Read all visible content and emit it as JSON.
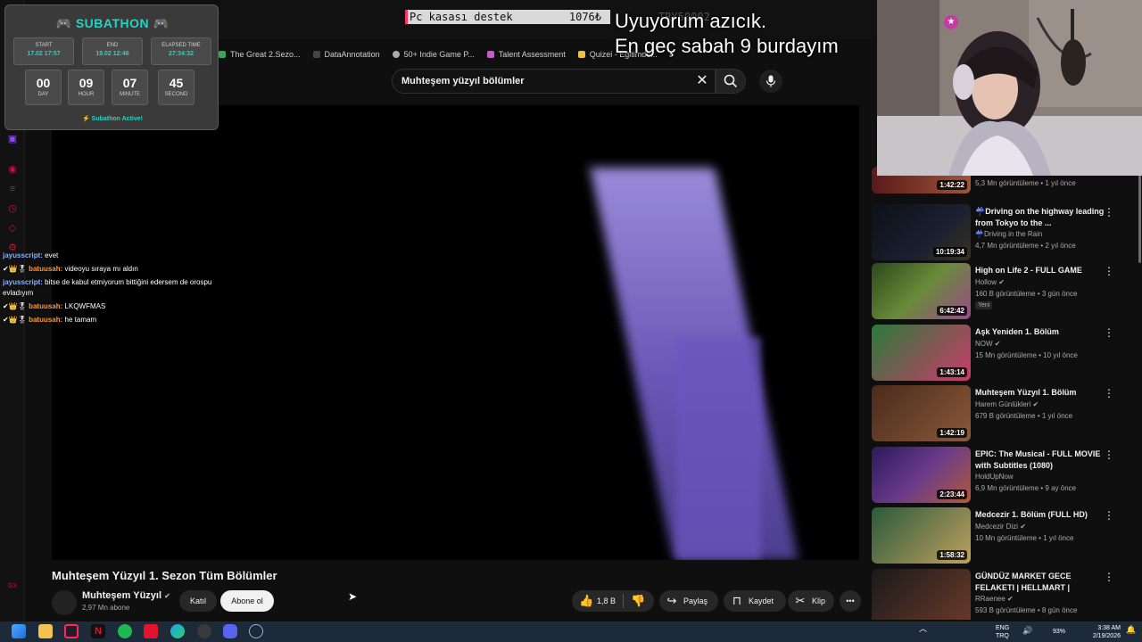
{
  "ticker": {
    "text": "Pc kasası destek",
    "amount": "1076₺",
    "extra": "TRY50002"
  },
  "overlay_text": {
    "line1": "Uyuyorum azıcık.",
    "line2": "En geç sabah 9 burdayım"
  },
  "subathon": {
    "title": "SUBATHON",
    "start_label": "START",
    "start_value": "17.02 17:57",
    "end_label": "END",
    "end_value": "19.02 12:46",
    "elapsed_label": "ELAPSED TIME",
    "elapsed_value": "27:34:32",
    "counters": [
      {
        "num": "00",
        "unit": "DAY"
      },
      {
        "num": "09",
        "unit": "HOUR"
      },
      {
        "num": "07",
        "unit": "MINUTE"
      },
      {
        "num": "45",
        "unit": "SECOND"
      }
    ],
    "status": "⚡ Subathon Active!"
  },
  "bookmarks": [
    "The Great 2.Sezo...",
    "DataAnnotation",
    "50+ Indie Game P...",
    "Talent Assessment",
    "Quizei - Eğitimde..."
  ],
  "search": {
    "value": "Muhteşem yüzyıl bölümler"
  },
  "chat": [
    {
      "user": "jayusscript:",
      "msg": "evet",
      "color": "#8fb4ff"
    },
    {
      "user": "batuusah:",
      "msg": "videoyu sıraya mı aldın",
      "color": "#ff9a3c",
      "badges": "✔👑🎖"
    },
    {
      "user": "jayusscript:",
      "msg": "bitse de kabul etmiyorum bittiğini edersem de orospu evladıyım",
      "color": "#8fb4ff"
    },
    {
      "user": "batuusah:",
      "msg": "LKQWFMAS",
      "color": "#ff9a3c",
      "badges": "✔👑🎖"
    },
    {
      "user": "batuusah:",
      "msg": "he tamam",
      "color": "#ff9a3c",
      "badges": "✔👑🎖"
    }
  ],
  "video": {
    "title": "Muhteşem Yüzyıl 1. Sezon Tüm Bölümler",
    "channel": "Muhteşem Yüzyıl",
    "subs": "2,97 Mn abone",
    "join_label": "Katıl",
    "subscribe_label": "Abone ol",
    "likes": "1,8 B",
    "share_label": "Paylaş",
    "save_label": "Kaydet",
    "clip_label": "Klip"
  },
  "recommended": [
    {
      "title": "",
      "channel": "",
      "meta": "5,3 Mn görüntüleme • 1 yıl önce",
      "duration": "1:42:22",
      "thumb": [
        "#5a1a1a",
        "#a0553a"
      ]
    },
    {
      "title": "☔Driving on the highway leading from Tokyo to the ...",
      "channel": "☔Driving in the Rain",
      "meta": "4,7 Mn görüntüleme • 2 yıl önce",
      "duration": "10:19:34",
      "thumb": [
        "#0d1018",
        "#3a3020"
      ]
    },
    {
      "title": "High on Life 2 - FULL GAME",
      "channel": "Hollow",
      "meta": "160 B görüntüleme • 3 gün önce",
      "duration": "6:42:42",
      "badge": "Yeni",
      "thumb": [
        "#2a4a1a",
        "#9a4a8a"
      ]
    },
    {
      "title": "Aşk Yeniden 1. Bölüm",
      "channel": "NOW",
      "meta": "15 Mn görüntüleme • 10 yıl önce",
      "duration": "1:43:14",
      "thumb": [
        "#2a7a3a",
        "#cc3a6a"
      ]
    },
    {
      "title": "Muhteşem Yüzyıl 1. Bölüm",
      "channel": "Harem Günlükleri",
      "meta": "679 B görüntüleme • 1 yıl önce",
      "duration": "1:42:19",
      "thumb": [
        "#4a2a1a",
        "#8a5a3a"
      ]
    },
    {
      "title": "EPIC: The Musical - FULL MOVIE with Subtitles (1080)",
      "channel": "HoldUpNow",
      "meta": "6,9 Mn görüntüleme • 9 ay önce",
      "duration": "2:23:44",
      "thumb": [
        "#2a1a5a",
        "#b05a3a"
      ]
    },
    {
      "title": "Medcezir 1. Bölüm (FULL HD)",
      "channel": "Medcezir Dizi",
      "meta": "10 Mn görüntüleme • 1 yıl önce",
      "duration": "1:58:32",
      "thumb": [
        "#2a5a3a",
        "#c0a060"
      ]
    },
    {
      "title": "GÜNDÜZ MARKET GECE FELAKETI | HELLMART |",
      "channel": "RRaenee",
      "meta": "593 B görüntüleme • 8 gün önce",
      "duration": "",
      "thumb": [
        "#1a1a1a",
        "#6a3a2a"
      ]
    }
  ],
  "taskbar": {
    "lang1": "ENG",
    "lang2": "TRQ",
    "battery": "93%",
    "time": "3:38 AM",
    "date": "2/19/2026"
  }
}
